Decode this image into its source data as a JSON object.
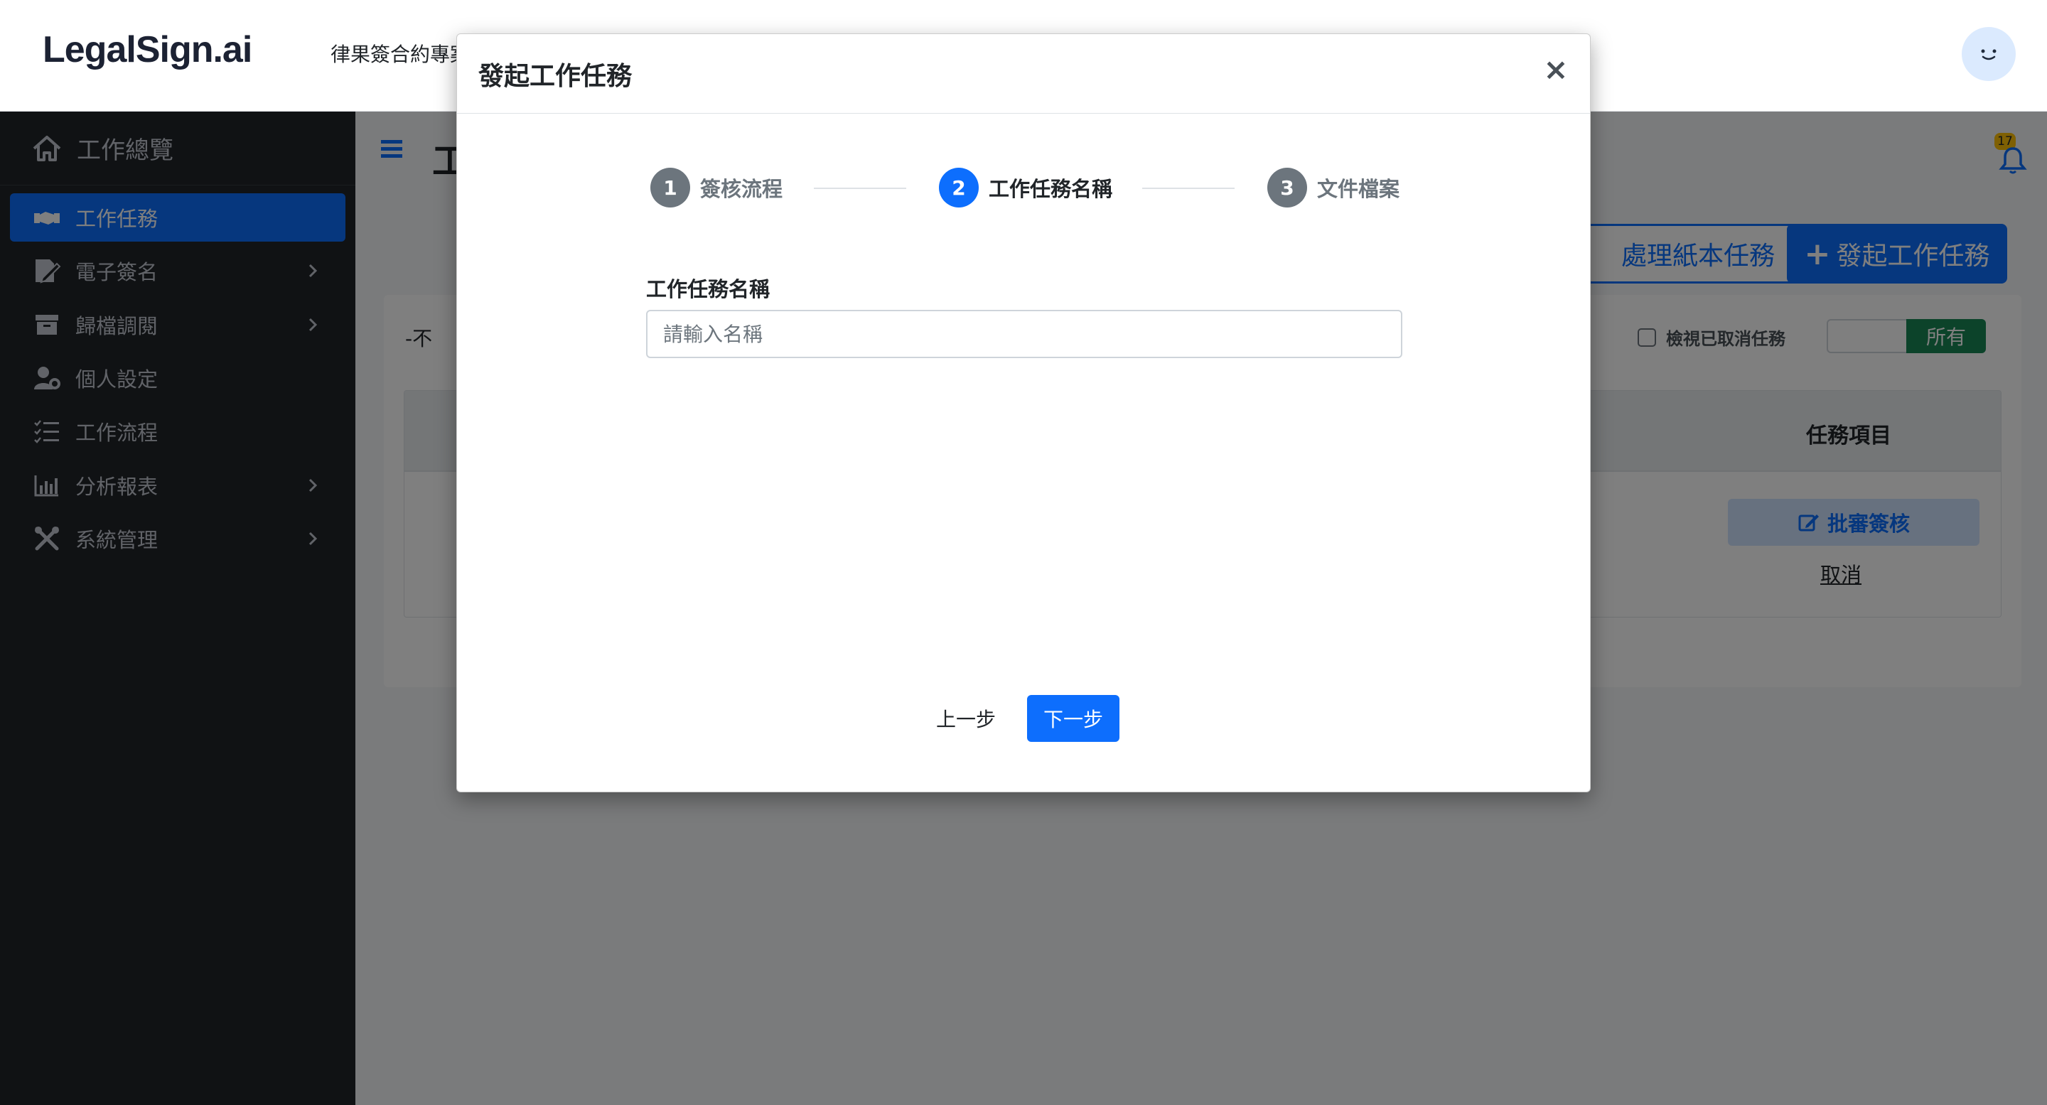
{
  "header": {
    "logo": "LegalSign.ai",
    "company": "律果簽合約專案",
    "avatar_icon": "smiley-face-icon"
  },
  "sidebar": {
    "home": {
      "label": "工作總覽",
      "icon": "home-icon"
    },
    "items": [
      {
        "label": "工作任務",
        "icon": "handshake-icon",
        "active": true,
        "has_children": false
      },
      {
        "label": "電子簽名",
        "icon": "signature-icon",
        "active": false,
        "has_children": true
      },
      {
        "label": "歸檔調閱",
        "icon": "archive-icon",
        "active": false,
        "has_children": true
      },
      {
        "label": "個人設定",
        "icon": "user-cog-icon",
        "active": false,
        "has_children": false
      },
      {
        "label": "工作流程",
        "icon": "list-check-icon",
        "active": false,
        "has_children": false
      },
      {
        "label": "分析報表",
        "icon": "bar-chart-icon",
        "active": false,
        "has_children": true
      },
      {
        "label": "系統管理",
        "icon": "tools-icon",
        "active": false,
        "has_children": true
      }
    ]
  },
  "main": {
    "page_title": "工",
    "notification_count": "17",
    "buttons": {
      "paper_task": "處理紙本任務",
      "start_task": "發起工作任務"
    },
    "filter": {
      "dropdown_value": "-不",
      "show_cancelled_label": "檢視已取消任務",
      "segment_all": "所有"
    },
    "table": {
      "column_task_items": "任務項目",
      "row_action_review": "批審簽核",
      "row_action_cancel": "取消"
    }
  },
  "modal": {
    "title": "發起工作任務",
    "close_label": "×",
    "steps": [
      {
        "number": "1",
        "label": "簽核流程",
        "active": false
      },
      {
        "number": "2",
        "label": "工作任務名稱",
        "active": true
      },
      {
        "number": "3",
        "label": "文件檔案",
        "active": false
      }
    ],
    "field_label": "工作任務名稱",
    "field_value": "",
    "field_placeholder": "請輸入名稱",
    "prev_label": "上一步",
    "next_label": "下一步"
  },
  "colors": {
    "primary": "#0d6efd",
    "sidebar_bg": "#212529",
    "success": "#198754",
    "badge": "#ffc107"
  }
}
